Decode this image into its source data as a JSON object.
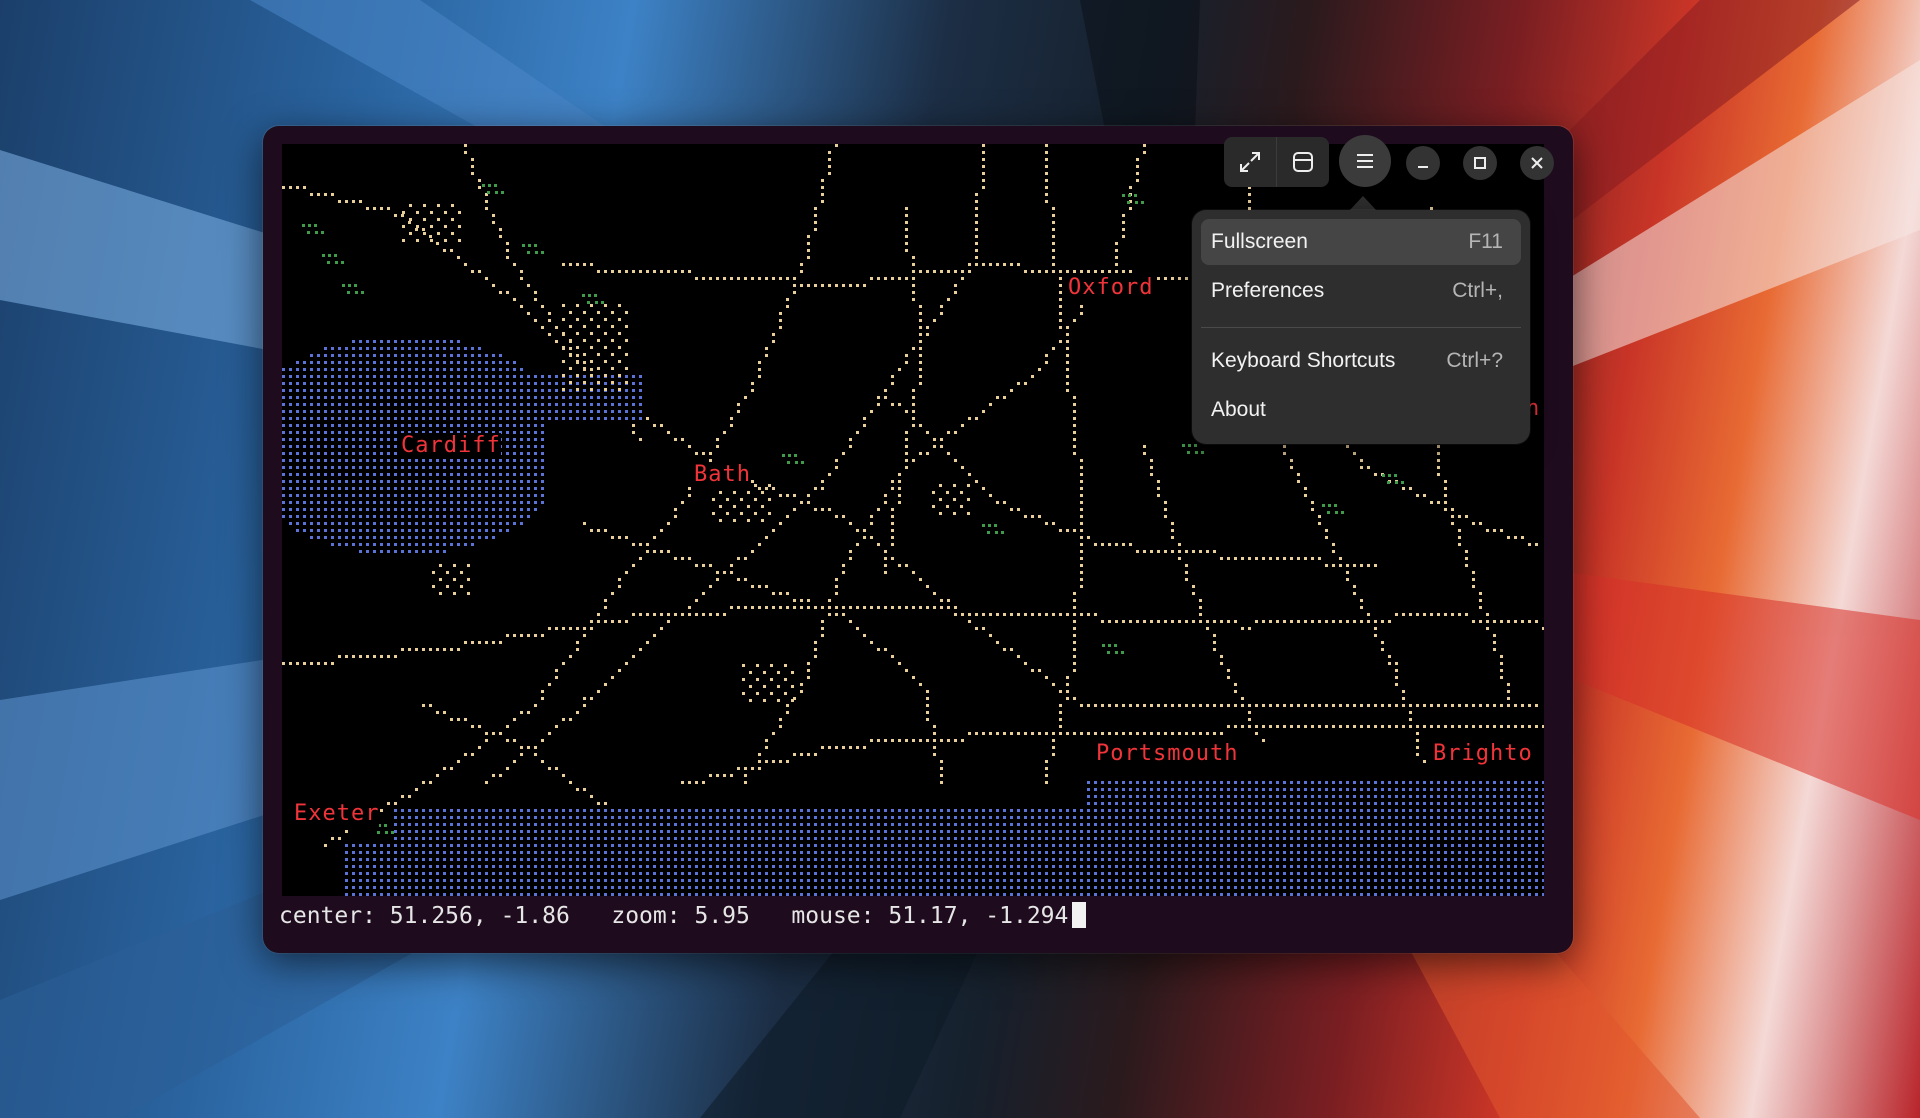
{
  "app": {
    "status": {
      "center_label": "center:",
      "center_value": "51.256, -1.86",
      "zoom_label": "zoom:",
      "zoom_value": "5.95",
      "mouse_label": "mouse:",
      "mouse_value": "51.17, -1.294"
    },
    "map": {
      "cities": [
        "Oxford",
        "Cardiff",
        "Bath",
        "Portsmouth",
        "Brighto",
        "Exeter",
        "n"
      ],
      "colors": {
        "background": "#000000",
        "roads": "#e8cf9a",
        "water": "#5b73d6",
        "parks": "#3f9a4a",
        "labels": "#f0343a"
      }
    },
    "headerbar": {
      "icons": [
        "fullscreen-arrows-icon",
        "tab-overview-icon",
        "hamburger-menu-icon",
        "minimize-icon",
        "maximize-icon",
        "close-icon"
      ]
    },
    "menu": {
      "items": [
        {
          "label": "Fullscreen",
          "accel": "F11"
        },
        {
          "label": "Preferences",
          "accel": "Ctrl+,"
        },
        {
          "label": "Keyboard Shortcuts",
          "accel": "Ctrl+?"
        },
        {
          "label": "About",
          "accel": ""
        }
      ]
    }
  }
}
